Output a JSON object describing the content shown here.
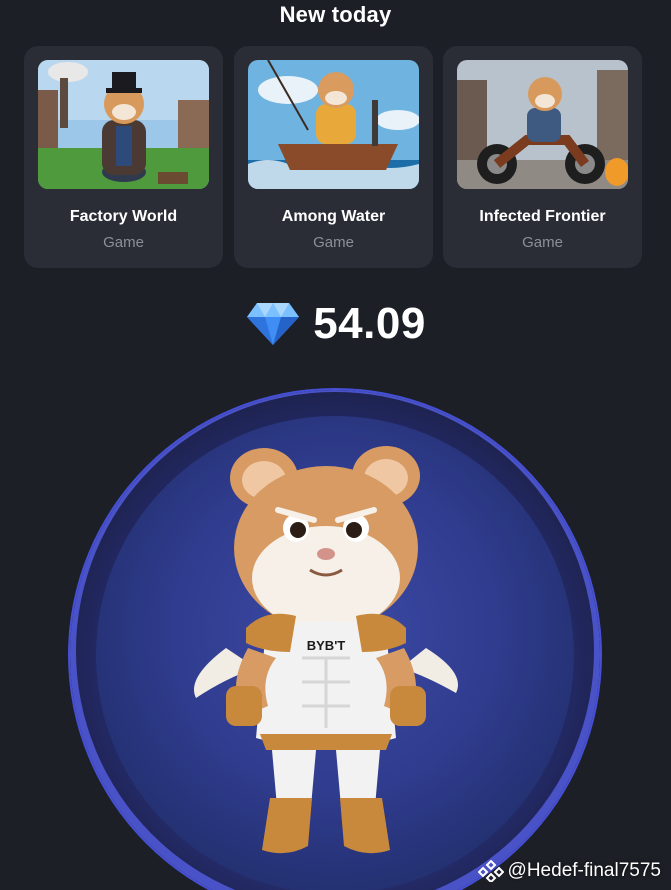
{
  "section": {
    "title": "New today"
  },
  "cards": [
    {
      "name": "Factory World",
      "type": "Game",
      "thumb_icon": "hamster-factory-thumbnail"
    },
    {
      "name": "Among Water",
      "type": "Game",
      "thumb_icon": "hamster-boat-thumbnail"
    },
    {
      "name": "Infected Frontier",
      "type": "Game",
      "thumb_icon": "hamster-motorcycle-thumbnail"
    }
  ],
  "balance": {
    "amount": "54.09",
    "icon": "diamond-icon"
  },
  "tap_area": {
    "character_icon": "hamster-bybit-character",
    "shirt_text": "BYB'T"
  },
  "watermark": {
    "text": "@Hedef-final7575",
    "icon": "binance-diamond-icon"
  },
  "colors": {
    "background": "#1c1f26",
    "card": "#2a2d35",
    "muted_text": "#8b8f99",
    "ring": "#4a52c8",
    "gem": "#4aa3ff"
  }
}
